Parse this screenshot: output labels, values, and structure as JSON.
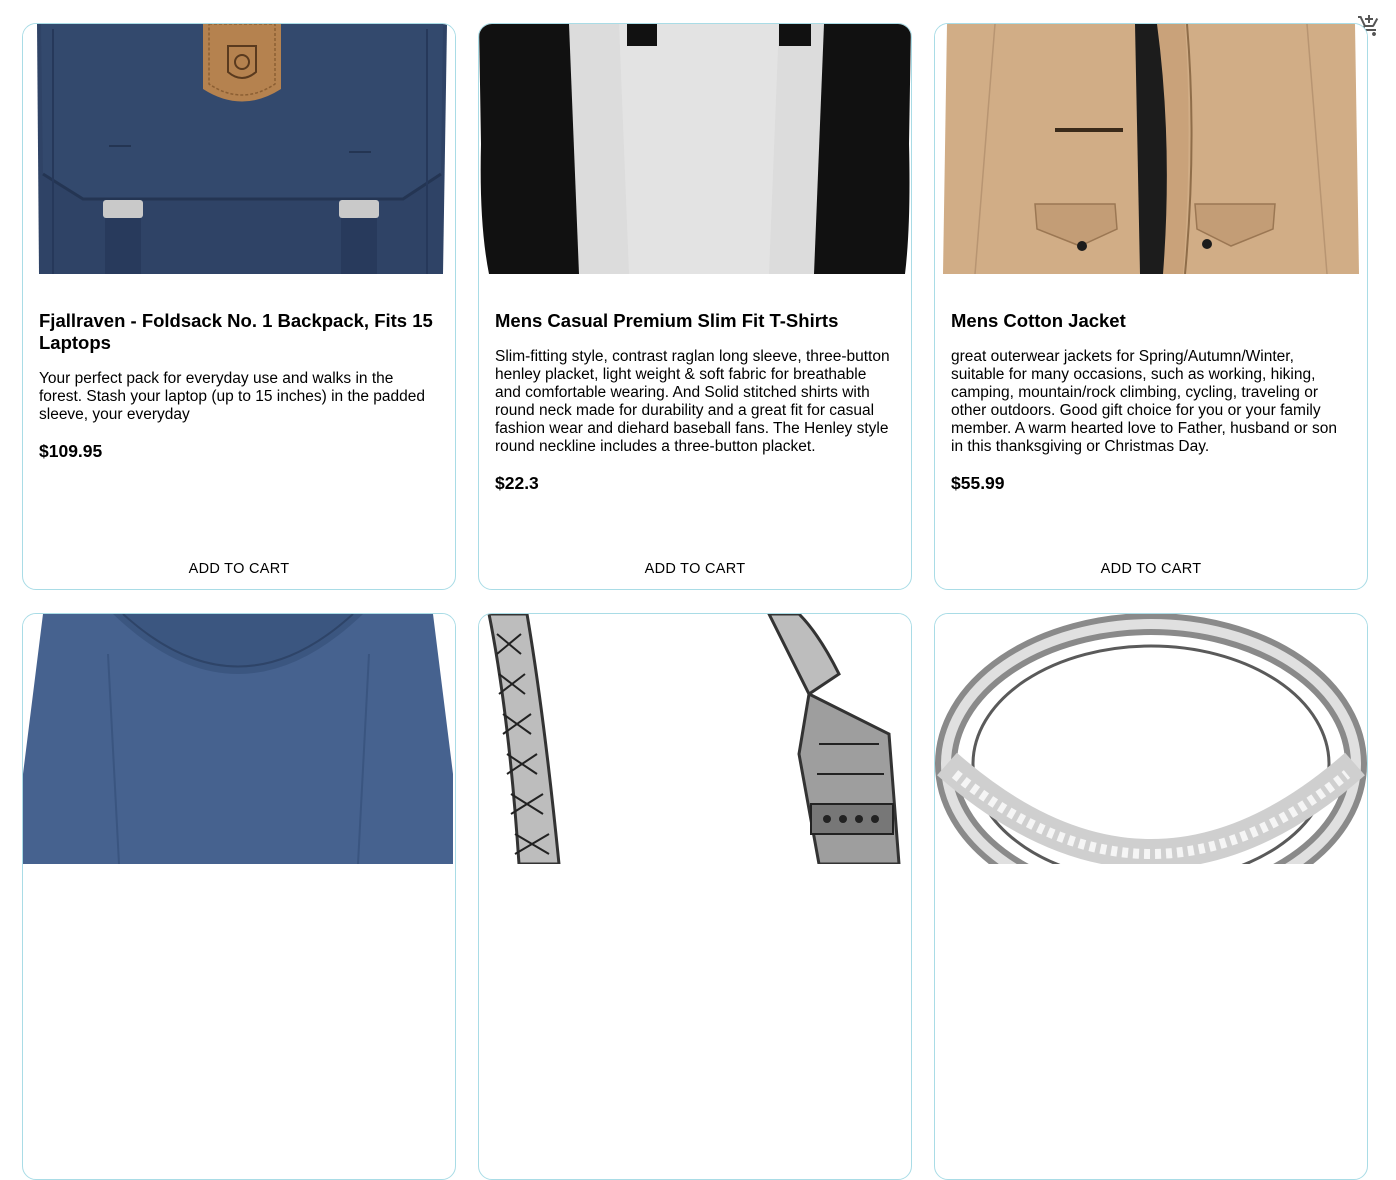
{
  "header": {
    "cart_icon": "add-shopping-cart-icon"
  },
  "products": [
    {
      "title": "Fjallraven - Foldsack No. 1 Backpack, Fits 15 Laptops",
      "description": "Your perfect pack for everyday use and walks in the forest. Stash your laptop (up to 15 inches) in the padded sleeve, your everyday",
      "price": "$109.95",
      "button": "ADD TO CART",
      "image_icon": "backpack-image"
    },
    {
      "title": "Mens Casual Premium Slim Fit T-Shirts",
      "description": "Slim-fitting style, contrast raglan long sleeve, three-button henley placket, light weight & soft fabric for breathable and comfortable wearing. And Solid stitched shirts with round neck made for durability and a great fit for casual fashion wear and diehard baseball fans. The Henley style round neckline includes a three-button placket.",
      "price": "$22.3",
      "button": "ADD TO CART",
      "image_icon": "tshirt-image"
    },
    {
      "title": "Mens Cotton Jacket",
      "description": "great outerwear jackets for Spring/Autumn/Winter, suitable for many occasions, such as working, hiking, camping, mountain/rock climbing, cycling, traveling or other outdoors. Good gift choice for you or your family member. A warm hearted love to Father, husband or son in this thanksgiving or Christmas Day.",
      "price": "$55.99",
      "button": "ADD TO CART",
      "image_icon": "jacket-image"
    },
    {
      "title": "",
      "description": "",
      "price": "",
      "button": "",
      "image_icon": "blue-shirt-image"
    },
    {
      "title": "",
      "description": "",
      "price": "",
      "button": "",
      "image_icon": "bracelet-image"
    },
    {
      "title": "",
      "description": "",
      "price": "",
      "button": "",
      "image_icon": "ring-image"
    }
  ],
  "colors": {
    "card_border": "#a9dce6",
    "backpack": "#2f4366",
    "jacket": "#d1ad86",
    "blue_shirt": "#46628f"
  }
}
